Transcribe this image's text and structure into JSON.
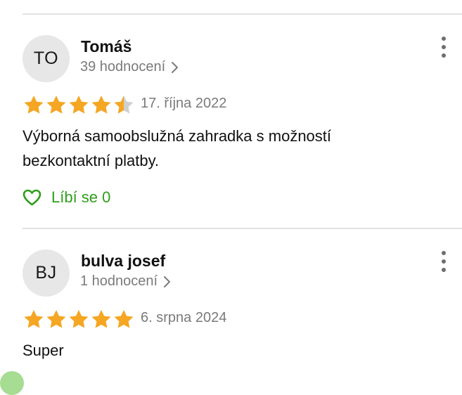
{
  "colors": {
    "star_fill": "#f5a623",
    "star_empty": "#cfcfcf",
    "like_green": "#2e9e1a",
    "avatar_bg": "#e7e7e7",
    "divider": "#e3e3e3",
    "meta_gray": "#7a7a7a"
  },
  "icons": {
    "star": "star-icon",
    "chevron": "chevron-right-icon",
    "menu": "more-vertical-icon",
    "heart": "heart-outline-icon"
  },
  "reviews": [
    {
      "initials": "TO",
      "author": "Tomáš",
      "rating_count": "39 hodnocení",
      "rating": 4.5,
      "date": "17. října 2022",
      "text": "Výborná samoobslužná zahradka s možností bezkontaktní platby.",
      "like_label": "Líbí se 0"
    },
    {
      "initials": "BJ",
      "author": "bulva josef",
      "rating_count": "1 hodnocení",
      "rating": 5,
      "date": "6. srpna 2024",
      "text": "Super"
    }
  ]
}
